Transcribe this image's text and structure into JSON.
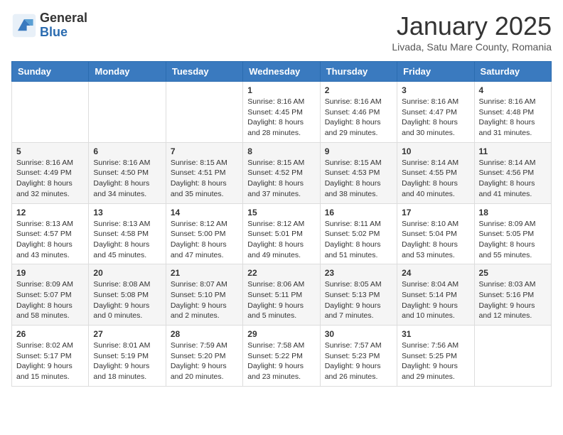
{
  "logo": {
    "general": "General",
    "blue": "Blue"
  },
  "title": "January 2025",
  "location": "Livada, Satu Mare County, Romania",
  "weekdays": [
    "Sunday",
    "Monday",
    "Tuesday",
    "Wednesday",
    "Thursday",
    "Friday",
    "Saturday"
  ],
  "weeks": [
    [
      {
        "day": "",
        "info": ""
      },
      {
        "day": "",
        "info": ""
      },
      {
        "day": "",
        "info": ""
      },
      {
        "day": "1",
        "info": "Sunrise: 8:16 AM\nSunset: 4:45 PM\nDaylight: 8 hours\nand 28 minutes."
      },
      {
        "day": "2",
        "info": "Sunrise: 8:16 AM\nSunset: 4:46 PM\nDaylight: 8 hours\nand 29 minutes."
      },
      {
        "day": "3",
        "info": "Sunrise: 8:16 AM\nSunset: 4:47 PM\nDaylight: 8 hours\nand 30 minutes."
      },
      {
        "day": "4",
        "info": "Sunrise: 8:16 AM\nSunset: 4:48 PM\nDaylight: 8 hours\nand 31 minutes."
      }
    ],
    [
      {
        "day": "5",
        "info": "Sunrise: 8:16 AM\nSunset: 4:49 PM\nDaylight: 8 hours\nand 32 minutes."
      },
      {
        "day": "6",
        "info": "Sunrise: 8:16 AM\nSunset: 4:50 PM\nDaylight: 8 hours\nand 34 minutes."
      },
      {
        "day": "7",
        "info": "Sunrise: 8:15 AM\nSunset: 4:51 PM\nDaylight: 8 hours\nand 35 minutes."
      },
      {
        "day": "8",
        "info": "Sunrise: 8:15 AM\nSunset: 4:52 PM\nDaylight: 8 hours\nand 37 minutes."
      },
      {
        "day": "9",
        "info": "Sunrise: 8:15 AM\nSunset: 4:53 PM\nDaylight: 8 hours\nand 38 minutes."
      },
      {
        "day": "10",
        "info": "Sunrise: 8:14 AM\nSunset: 4:55 PM\nDaylight: 8 hours\nand 40 minutes."
      },
      {
        "day": "11",
        "info": "Sunrise: 8:14 AM\nSunset: 4:56 PM\nDaylight: 8 hours\nand 41 minutes."
      }
    ],
    [
      {
        "day": "12",
        "info": "Sunrise: 8:13 AM\nSunset: 4:57 PM\nDaylight: 8 hours\nand 43 minutes."
      },
      {
        "day": "13",
        "info": "Sunrise: 8:13 AM\nSunset: 4:58 PM\nDaylight: 8 hours\nand 45 minutes."
      },
      {
        "day": "14",
        "info": "Sunrise: 8:12 AM\nSunset: 5:00 PM\nDaylight: 8 hours\nand 47 minutes."
      },
      {
        "day": "15",
        "info": "Sunrise: 8:12 AM\nSunset: 5:01 PM\nDaylight: 8 hours\nand 49 minutes."
      },
      {
        "day": "16",
        "info": "Sunrise: 8:11 AM\nSunset: 5:02 PM\nDaylight: 8 hours\nand 51 minutes."
      },
      {
        "day": "17",
        "info": "Sunrise: 8:10 AM\nSunset: 5:04 PM\nDaylight: 8 hours\nand 53 minutes."
      },
      {
        "day": "18",
        "info": "Sunrise: 8:09 AM\nSunset: 5:05 PM\nDaylight: 8 hours\nand 55 minutes."
      }
    ],
    [
      {
        "day": "19",
        "info": "Sunrise: 8:09 AM\nSunset: 5:07 PM\nDaylight: 8 hours\nand 58 minutes."
      },
      {
        "day": "20",
        "info": "Sunrise: 8:08 AM\nSunset: 5:08 PM\nDaylight: 9 hours\nand 0 minutes."
      },
      {
        "day": "21",
        "info": "Sunrise: 8:07 AM\nSunset: 5:10 PM\nDaylight: 9 hours\nand 2 minutes."
      },
      {
        "day": "22",
        "info": "Sunrise: 8:06 AM\nSunset: 5:11 PM\nDaylight: 9 hours\nand 5 minutes."
      },
      {
        "day": "23",
        "info": "Sunrise: 8:05 AM\nSunset: 5:13 PM\nDaylight: 9 hours\nand 7 minutes."
      },
      {
        "day": "24",
        "info": "Sunrise: 8:04 AM\nSunset: 5:14 PM\nDaylight: 9 hours\nand 10 minutes."
      },
      {
        "day": "25",
        "info": "Sunrise: 8:03 AM\nSunset: 5:16 PM\nDaylight: 9 hours\nand 12 minutes."
      }
    ],
    [
      {
        "day": "26",
        "info": "Sunrise: 8:02 AM\nSunset: 5:17 PM\nDaylight: 9 hours\nand 15 minutes."
      },
      {
        "day": "27",
        "info": "Sunrise: 8:01 AM\nSunset: 5:19 PM\nDaylight: 9 hours\nand 18 minutes."
      },
      {
        "day": "28",
        "info": "Sunrise: 7:59 AM\nSunset: 5:20 PM\nDaylight: 9 hours\nand 20 minutes."
      },
      {
        "day": "29",
        "info": "Sunrise: 7:58 AM\nSunset: 5:22 PM\nDaylight: 9 hours\nand 23 minutes."
      },
      {
        "day": "30",
        "info": "Sunrise: 7:57 AM\nSunset: 5:23 PM\nDaylight: 9 hours\nand 26 minutes."
      },
      {
        "day": "31",
        "info": "Sunrise: 7:56 AM\nSunset: 5:25 PM\nDaylight: 9 hours\nand 29 minutes."
      },
      {
        "day": "",
        "info": ""
      }
    ]
  ]
}
